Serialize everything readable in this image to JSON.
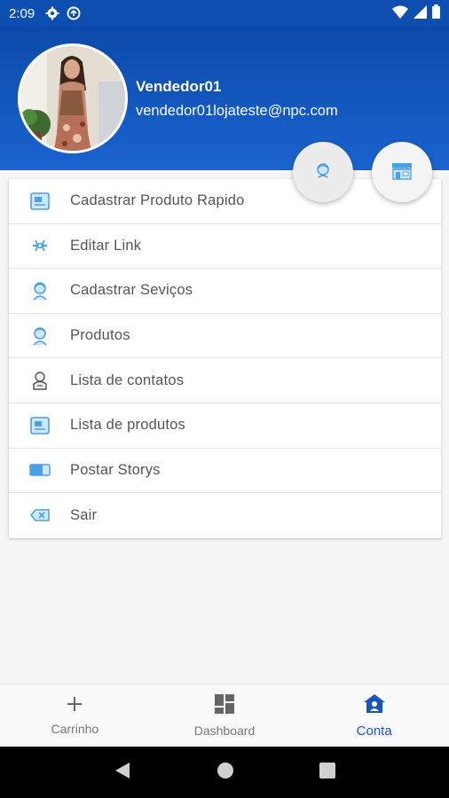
{
  "status_bar": {
    "time": "2:09",
    "icons": [
      "gear-icon",
      "sync-icon",
      "wifi-icon",
      "signal-icon",
      "battery-icon"
    ]
  },
  "profile": {
    "name": "Vendedor01",
    "email": "vendedor01lojateste@npc.com"
  },
  "fab": {
    "icons": [
      "seller-icon",
      "store-icon"
    ]
  },
  "menu": {
    "items": [
      {
        "label": "Cadastrar Produto Rapido",
        "icon": "box-icon"
      },
      {
        "label": "Editar Link",
        "icon": "link-tool-icon"
      },
      {
        "label": "Cadastrar Seviços",
        "icon": "service-person-icon"
      },
      {
        "label": "Produtos",
        "icon": "products-person-icon"
      },
      {
        "label": "Lista de contatos",
        "icon": "contacts-icon"
      },
      {
        "label": "Lista de produtos",
        "icon": "product-list-icon"
      },
      {
        "label": "Postar Storys",
        "icon": "story-icon"
      },
      {
        "label": "Sair",
        "icon": "exit-icon"
      }
    ]
  },
  "bottom_nav": {
    "items": [
      {
        "label": "Carrinho",
        "icon": "plus-icon",
        "active": false
      },
      {
        "label": "Dashboard",
        "icon": "dashboard-icon",
        "active": false
      },
      {
        "label": "Conta",
        "icon": "account-home-icon",
        "active": true
      }
    ]
  },
  "colors": {
    "header": "#0b4aa9",
    "accent": "#1a55b8",
    "icon_blue": "#5aa8e6"
  }
}
